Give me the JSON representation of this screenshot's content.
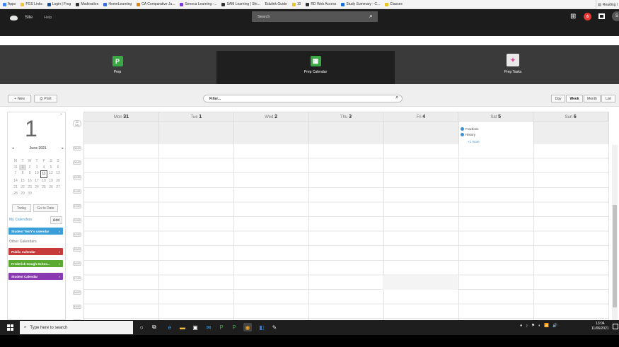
{
  "bookmarks": [
    {
      "icon": "apps-icon",
      "label": "Apps",
      "color": "#4285f4"
    },
    {
      "icon": "folder-icon",
      "label": "FGS Links",
      "color": "#f4c430"
    },
    {
      "icon": "login-icon",
      "label": "Login | Frog",
      "color": "#1a4fa0"
    },
    {
      "icon": "moderation-icon",
      "label": "Moderation",
      "color": "#333333"
    },
    {
      "icon": "homelearning-icon",
      "label": "HomeLearning",
      "color": "#3a6fd8"
    },
    {
      "icon": "ca-icon",
      "label": "CA Comparative Ju...",
      "color": "#e0841a"
    },
    {
      "icon": "seneca-icon",
      "label": "Seneca Learning -...",
      "color": "#7a3ad8"
    },
    {
      "icon": "sam-icon",
      "label": "SAM Learning | Shi...",
      "color": "#333333"
    },
    {
      "icon": "",
      "label": "Edulink Guide",
      "color": ""
    },
    {
      "icon": "ten-icon",
      "label": "10",
      "color": "#e8c51a"
    },
    {
      "icon": "web-icon",
      "label": "RD Web Access",
      "color": "#333333"
    },
    {
      "icon": "study-icon",
      "label": "Study Summary - C...",
      "color": "#1a6ed8"
    },
    {
      "icon": "classes-icon",
      "label": "Classes",
      "color": "#e8c51a"
    }
  ],
  "reading_list": "Reading l",
  "site": {
    "label": "Site",
    "help": "Help",
    "search_placeholder": "Search",
    "notifications": "6",
    "avatar": "S"
  },
  "apps": [
    {
      "label": "Prep",
      "glyph": "P"
    },
    {
      "label": "Prep Calendar",
      "glyph": "▦"
    },
    {
      "label": "Prep Tasks",
      "glyph": "✦"
    }
  ],
  "toolbar": {
    "new": "New",
    "print": "Print",
    "filter": "Filter...",
    "views": [
      "Day",
      "Week",
      "Month",
      "List"
    ],
    "active_view": "Week"
  },
  "sidebar": {
    "day": "1",
    "month": "June 2021",
    "weekdays": [
      "M",
      "T",
      "W",
      "T",
      "F",
      "S",
      "S"
    ],
    "weeks": [
      [
        "",
        "",
        "",
        "",
        "",
        "",
        ""
      ],
      [
        "31",
        "1",
        "2",
        "3",
        "4",
        "5",
        "6"
      ],
      [
        "7",
        "8",
        "9",
        "10",
        "11",
        "12",
        "13"
      ],
      [
        "14",
        "15",
        "16",
        "17",
        "18",
        "19",
        "20"
      ],
      [
        "21",
        "22",
        "23",
        "24",
        "25",
        "26",
        "27"
      ],
      [
        "28",
        "29",
        "30",
        "",
        "",
        "",
        ""
      ]
    ],
    "today_btn": "Today",
    "goto_btn": "Go to Date",
    "my_calendars": "My Calendars",
    "add_btn": "Add",
    "other_calendars": "Other Calendars",
    "calendars": [
      {
        "name": "Student TestY's calendar",
        "color": "#3a9fd8",
        "section": "my"
      },
      {
        "name": "Public Calendar",
        "color": "#c73a3a",
        "section": "other"
      },
      {
        "name": "Frederick Gough Schoo...",
        "color": "#5aaa32",
        "section": "other"
      },
      {
        "name": "Student Calendar",
        "color": "#8a3ab0",
        "section": "other"
      }
    ]
  },
  "calendar": {
    "all_day": "All Day",
    "days": [
      {
        "name": "Mon",
        "num": "31"
      },
      {
        "name": "Tue",
        "num": "1"
      },
      {
        "name": "Wed",
        "num": "2"
      },
      {
        "name": "Thu",
        "num": "3"
      },
      {
        "name": "Fri",
        "num": "4"
      },
      {
        "name": "Sat",
        "num": "5"
      },
      {
        "name": "Sun",
        "num": "6"
      }
    ],
    "times": [
      "08:00",
      "09:00",
      "10:00",
      "11:00",
      "12:00",
      "13:00",
      "14:00",
      "15:00",
      "16:00",
      "17:00",
      "18:00",
      "19:00",
      "20:00"
    ],
    "sat_events": [
      "Fractions",
      "History"
    ],
    "more": "+1 more"
  },
  "taskbar": {
    "search": "Type here to search",
    "time": "13:04",
    "date": "11/06/2021"
  }
}
